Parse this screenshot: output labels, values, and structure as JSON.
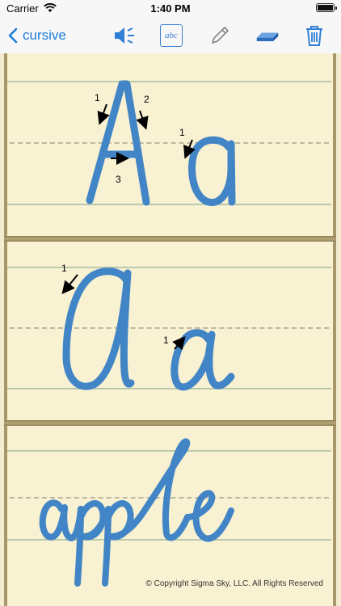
{
  "status_bar": {
    "carrier": "Carrier",
    "time": "1:40 PM"
  },
  "nav": {
    "back_label": "cursive",
    "abc_label": "abc",
    "icons": [
      "speaker-icon",
      "abc-icon",
      "pencil-icon",
      "eraser-icon",
      "trash-icon"
    ],
    "accent_color": "#1e7bd9"
  },
  "panels": {
    "print": {
      "letters": "Aa",
      "stroke_numbers": [
        "1",
        "2",
        "3",
        "1"
      ]
    },
    "cursive": {
      "letters": "Aa",
      "stroke_numbers": [
        "1",
        "1"
      ]
    },
    "word": {
      "text": "apple"
    }
  },
  "copyright": "© Copyright  Sigma Sky, LLC. All Rights Reserved",
  "colors": {
    "ink": "#3f82c4",
    "paper": "#f8f1d2",
    "frame": "#a8976a"
  }
}
